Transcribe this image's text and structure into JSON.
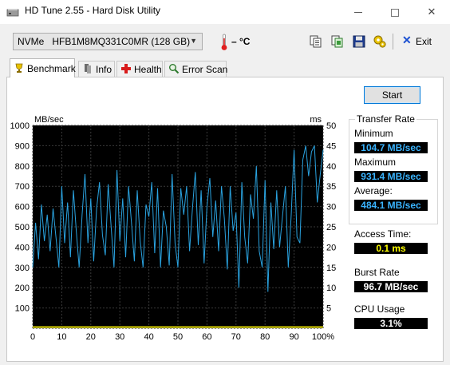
{
  "window": {
    "title": "HD Tune 2.55 - Hard Disk Utility"
  },
  "toolbar": {
    "drive_type": "NVMe",
    "drive_name": "HFB1M8MQ331C0MR (128 GB)",
    "temperature": "– °C",
    "exit_label": "Exit",
    "icons": [
      "copy-icon",
      "copy-screenshot-icon",
      "save-icon",
      "options-icon"
    ]
  },
  "tabs": [
    {
      "label": "Benchmark",
      "icon": "benchmark-icon",
      "active": true
    },
    {
      "label": "Info",
      "icon": "info-icon",
      "active": false
    },
    {
      "label": "Health",
      "icon": "health-icon",
      "active": false
    },
    {
      "label": "Error Scan",
      "icon": "error-scan-icon",
      "active": false
    }
  ],
  "benchmark": {
    "start_label": "Start",
    "transfer_rate_title": "Transfer Rate",
    "minimum_label": "Minimum",
    "minimum_value": "104.7 MB/sec",
    "maximum_label": "Maximum",
    "maximum_value": "931.4 MB/sec",
    "average_label": "Average:",
    "average_value": "484.1 MB/sec",
    "access_time_label": "Access Time:",
    "access_time_value": "0.1 ms",
    "burst_rate_label": "Burst Rate",
    "burst_rate_value": "96.7 MB/sec",
    "cpu_usage_label": "CPU Usage",
    "cpu_usage_value": "3.1%"
  },
  "colors": {
    "plot_background": "#000000",
    "grid": "#3a3a3a",
    "transfer_line": "#2aa3e0",
    "access_line": "#e0d800",
    "value_blue": "#3ab4ff",
    "value_yellow": "#ffff00"
  },
  "chart_data": {
    "type": "line",
    "xlabel": "%",
    "ylabel_left": "MB/sec",
    "ylabel_right": "ms",
    "xlim": [
      0,
      100
    ],
    "ylim_left": [
      0,
      1000
    ],
    "ylim_right": [
      0,
      50
    ],
    "x_ticks": [
      "0",
      "10",
      "20",
      "30",
      "40",
      "50",
      "60",
      "70",
      "80",
      "90",
      "100%"
    ],
    "y_ticks_left": [
      "100",
      "200",
      "300",
      "400",
      "500",
      "600",
      "700",
      "800",
      "900",
      "1000"
    ],
    "y_ticks_right": [
      "5",
      "10",
      "15",
      "20",
      "25",
      "30",
      "35",
      "40",
      "45",
      "50"
    ],
    "grid": true,
    "series": [
      {
        "axis": "left",
        "color": "#2aa3e0",
        "x": [
          0,
          1,
          2,
          3,
          4,
          5,
          6,
          7,
          8,
          9,
          10,
          11,
          12,
          13,
          14,
          15,
          16,
          17,
          18,
          19,
          20,
          21,
          22,
          23,
          24,
          25,
          26,
          27,
          28,
          29,
          30,
          31,
          32,
          33,
          34,
          35,
          36,
          37,
          38,
          39,
          40,
          41,
          42,
          43,
          44,
          45,
          46,
          47,
          48,
          49,
          50,
          51,
          52,
          53,
          54,
          55,
          56,
          57,
          58,
          59,
          60,
          61,
          62,
          63,
          64,
          65,
          66,
          67,
          68,
          69,
          70,
          71,
          72,
          73,
          74,
          75,
          76,
          77,
          78,
          79,
          80,
          81,
          82,
          83,
          84,
          85,
          86,
          87,
          88,
          89,
          90,
          91,
          92,
          93,
          94,
          95,
          96,
          97,
          98,
          99,
          100
        ],
        "y": [
          300,
          520,
          340,
          610,
          430,
          560,
          380,
          590,
          450,
          300,
          700,
          420,
          620,
          350,
          680,
          480,
          300,
          560,
          760,
          420,
          640,
          330,
          590,
          720,
          460,
          360,
          710,
          500,
          300,
          780,
          430,
          640,
          350,
          700,
          520,
          330,
          680,
          430,
          300,
          610,
          550,
          720,
          370,
          690,
          300,
          580,
          500,
          310,
          760,
          420,
          300,
          690,
          560,
          700,
          380,
          590,
          770,
          410,
          680,
          320,
          600,
          740,
          450,
          630,
          380,
          700,
          540,
          290,
          700,
          480,
          570,
          200,
          720,
          450,
          320,
          660,
          540,
          800,
          380,
          300,
          730,
          180,
          620,
          390,
          680,
          400,
          550,
          700,
          300,
          560,
          880,
          450,
          420,
          830,
          900,
          750,
          870,
          900,
          620,
          760,
          880
        ]
      },
      {
        "axis": "right",
        "color": "#e0d800",
        "x": [
          0,
          10,
          20,
          30,
          40,
          50,
          60,
          70,
          80,
          90,
          100
        ],
        "y": [
          0.1,
          0.1,
          0.1,
          0.1,
          0.1,
          0.1,
          0.1,
          0.1,
          0.1,
          0.1,
          0.1
        ]
      }
    ]
  }
}
